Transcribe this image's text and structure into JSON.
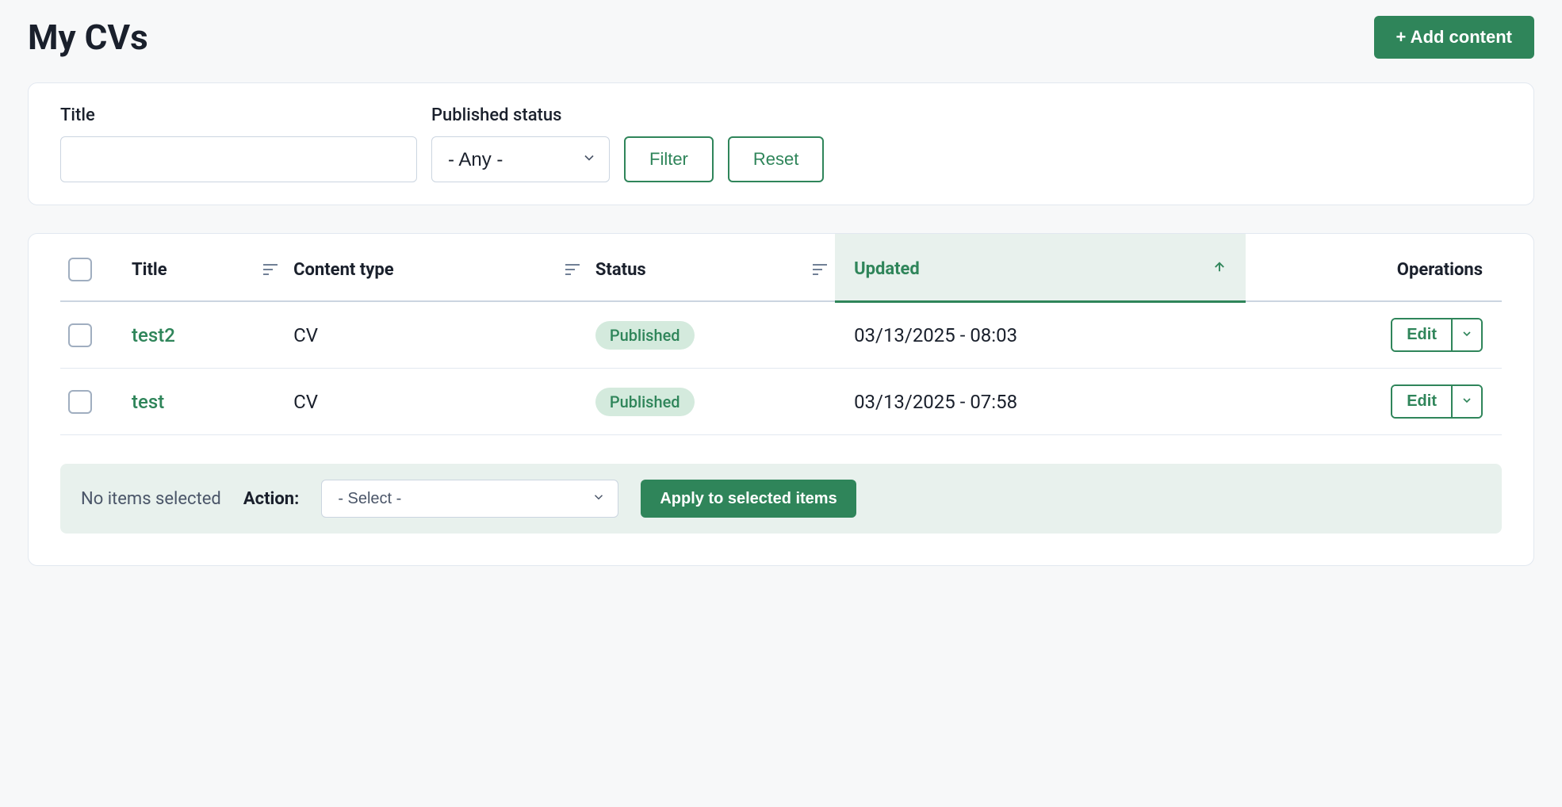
{
  "page_title": "My CVs",
  "add_button": "+ Add content",
  "filters": {
    "title_label": "Title",
    "title_value": "",
    "status_label": "Published status",
    "status_value": "- Any -",
    "filter_button": "Filter",
    "reset_button": "Reset"
  },
  "table": {
    "headers": {
      "title": "Title",
      "content_type": "Content type",
      "status": "Status",
      "updated": "Updated",
      "operations": "Operations"
    },
    "rows": [
      {
        "title": "test2",
        "content_type": "CV",
        "status": "Published",
        "updated": "03/13/2025 - 08:03",
        "edit": "Edit"
      },
      {
        "title": "test",
        "content_type": "CV",
        "status": "Published",
        "updated": "03/13/2025 - 07:58",
        "edit": "Edit"
      }
    ]
  },
  "bulk": {
    "selection_text": "No items selected",
    "action_label": "Action:",
    "action_value": "- Select -",
    "apply_button": "Apply to selected items"
  }
}
